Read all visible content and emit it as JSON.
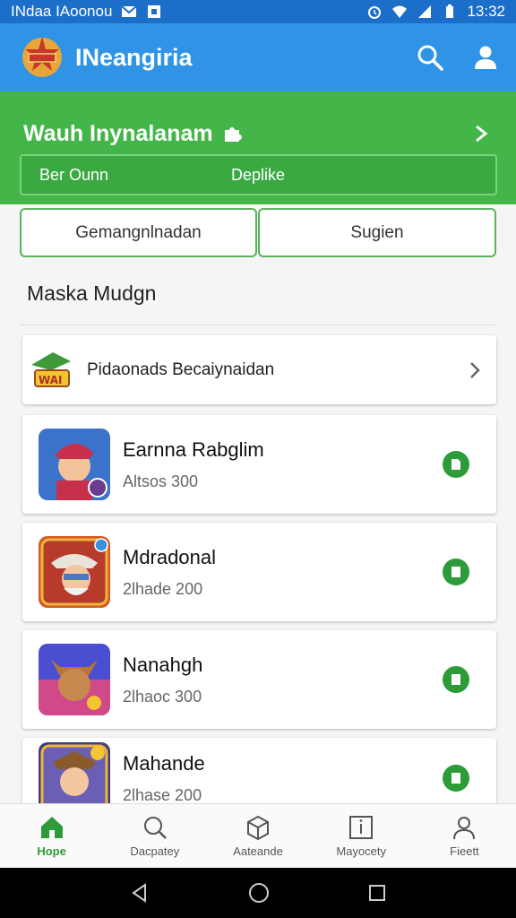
{
  "status_bar": {
    "left_text": "INdaa IAoonou",
    "time": "13:32"
  },
  "app_bar": {
    "title": "INeangiria",
    "search_icon": "search-icon",
    "account_icon": "account-icon"
  },
  "banner": {
    "title": "Wauh Inynalanam",
    "chip_left": "Ber Ounn",
    "chip_right": "Deplike"
  },
  "segments": {
    "left": "Gemangnlnadan",
    "right": "Sugien"
  },
  "section_title": "Maska Mudgn",
  "promo": {
    "label": "Pidaonads Becaiynaidan"
  },
  "games": [
    {
      "name": "Earnna Rabglim",
      "sub": "Altsos 300"
    },
    {
      "name": "Mdradonal",
      "sub": "2lhade 200"
    },
    {
      "name": "Nanahgh",
      "sub": "2lhaoc 300"
    },
    {
      "name": "Mahande",
      "sub": "2lhase 200"
    }
  ],
  "bottom_nav": [
    {
      "label": "Hope",
      "icon": "home-icon"
    },
    {
      "label": "Dacpatey",
      "icon": "search-icon"
    },
    {
      "label": "Aateande",
      "icon": "box-icon"
    },
    {
      "label": "Mayocety",
      "icon": "info-icon"
    },
    {
      "label": "Fieett",
      "icon": "profile-icon"
    }
  ],
  "colors": {
    "app_bar": "#2f93e6",
    "status_bar": "#1c6fc9",
    "banner": "#44b649",
    "accent": "#2e9b39"
  }
}
